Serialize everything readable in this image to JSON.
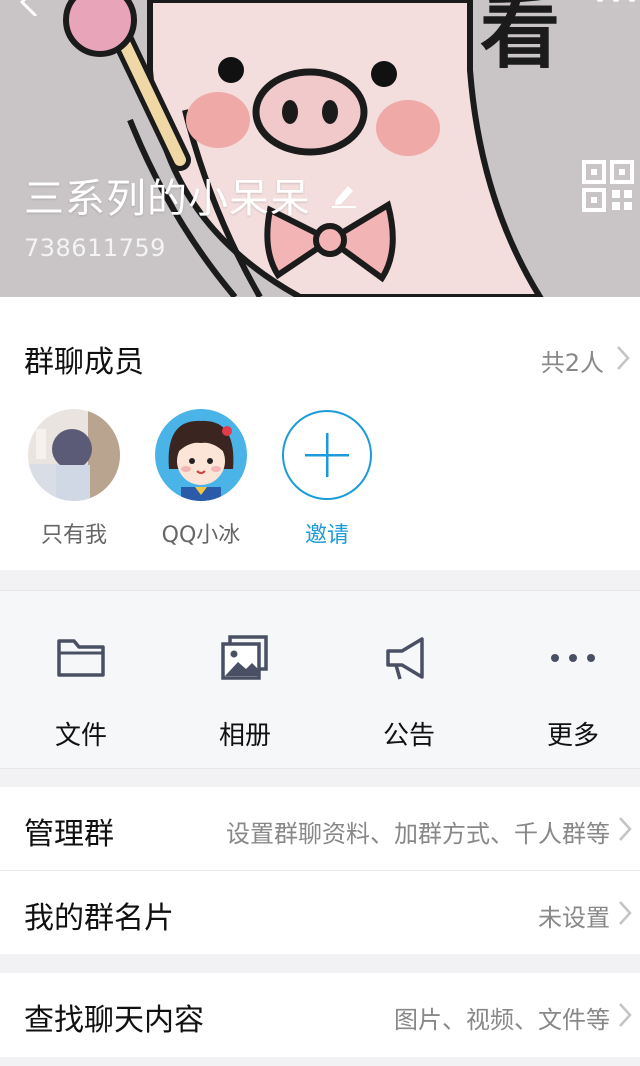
{
  "header": {
    "group_name": "三系列的小呆呆",
    "group_id": "738611759",
    "sticker_text": "看"
  },
  "members": {
    "title": "群聊成员",
    "count": "共2人",
    "list": [
      {
        "label": "只有我"
      },
      {
        "label": "QQ小冰"
      },
      {
        "label": "邀请"
      }
    ]
  },
  "actions": [
    {
      "label": "文件",
      "icon": "folder-icon"
    },
    {
      "label": "相册",
      "icon": "album-icon"
    },
    {
      "label": "公告",
      "icon": "megaphone-icon"
    },
    {
      "label": "更多",
      "icon": "more-dots-icon"
    }
  ],
  "settings": {
    "manage": {
      "title": "管理群",
      "value": "设置群聊资料、加群方式、千人群等"
    },
    "card": {
      "title": "我的群名片",
      "value": "未设置"
    },
    "search": {
      "title": "查找聊天内容",
      "value": "图片、视频、文件等"
    }
  },
  "colors": {
    "accent": "#1d9bd8",
    "header_bg": "#c9c5c6",
    "icon": "#4a5063"
  }
}
